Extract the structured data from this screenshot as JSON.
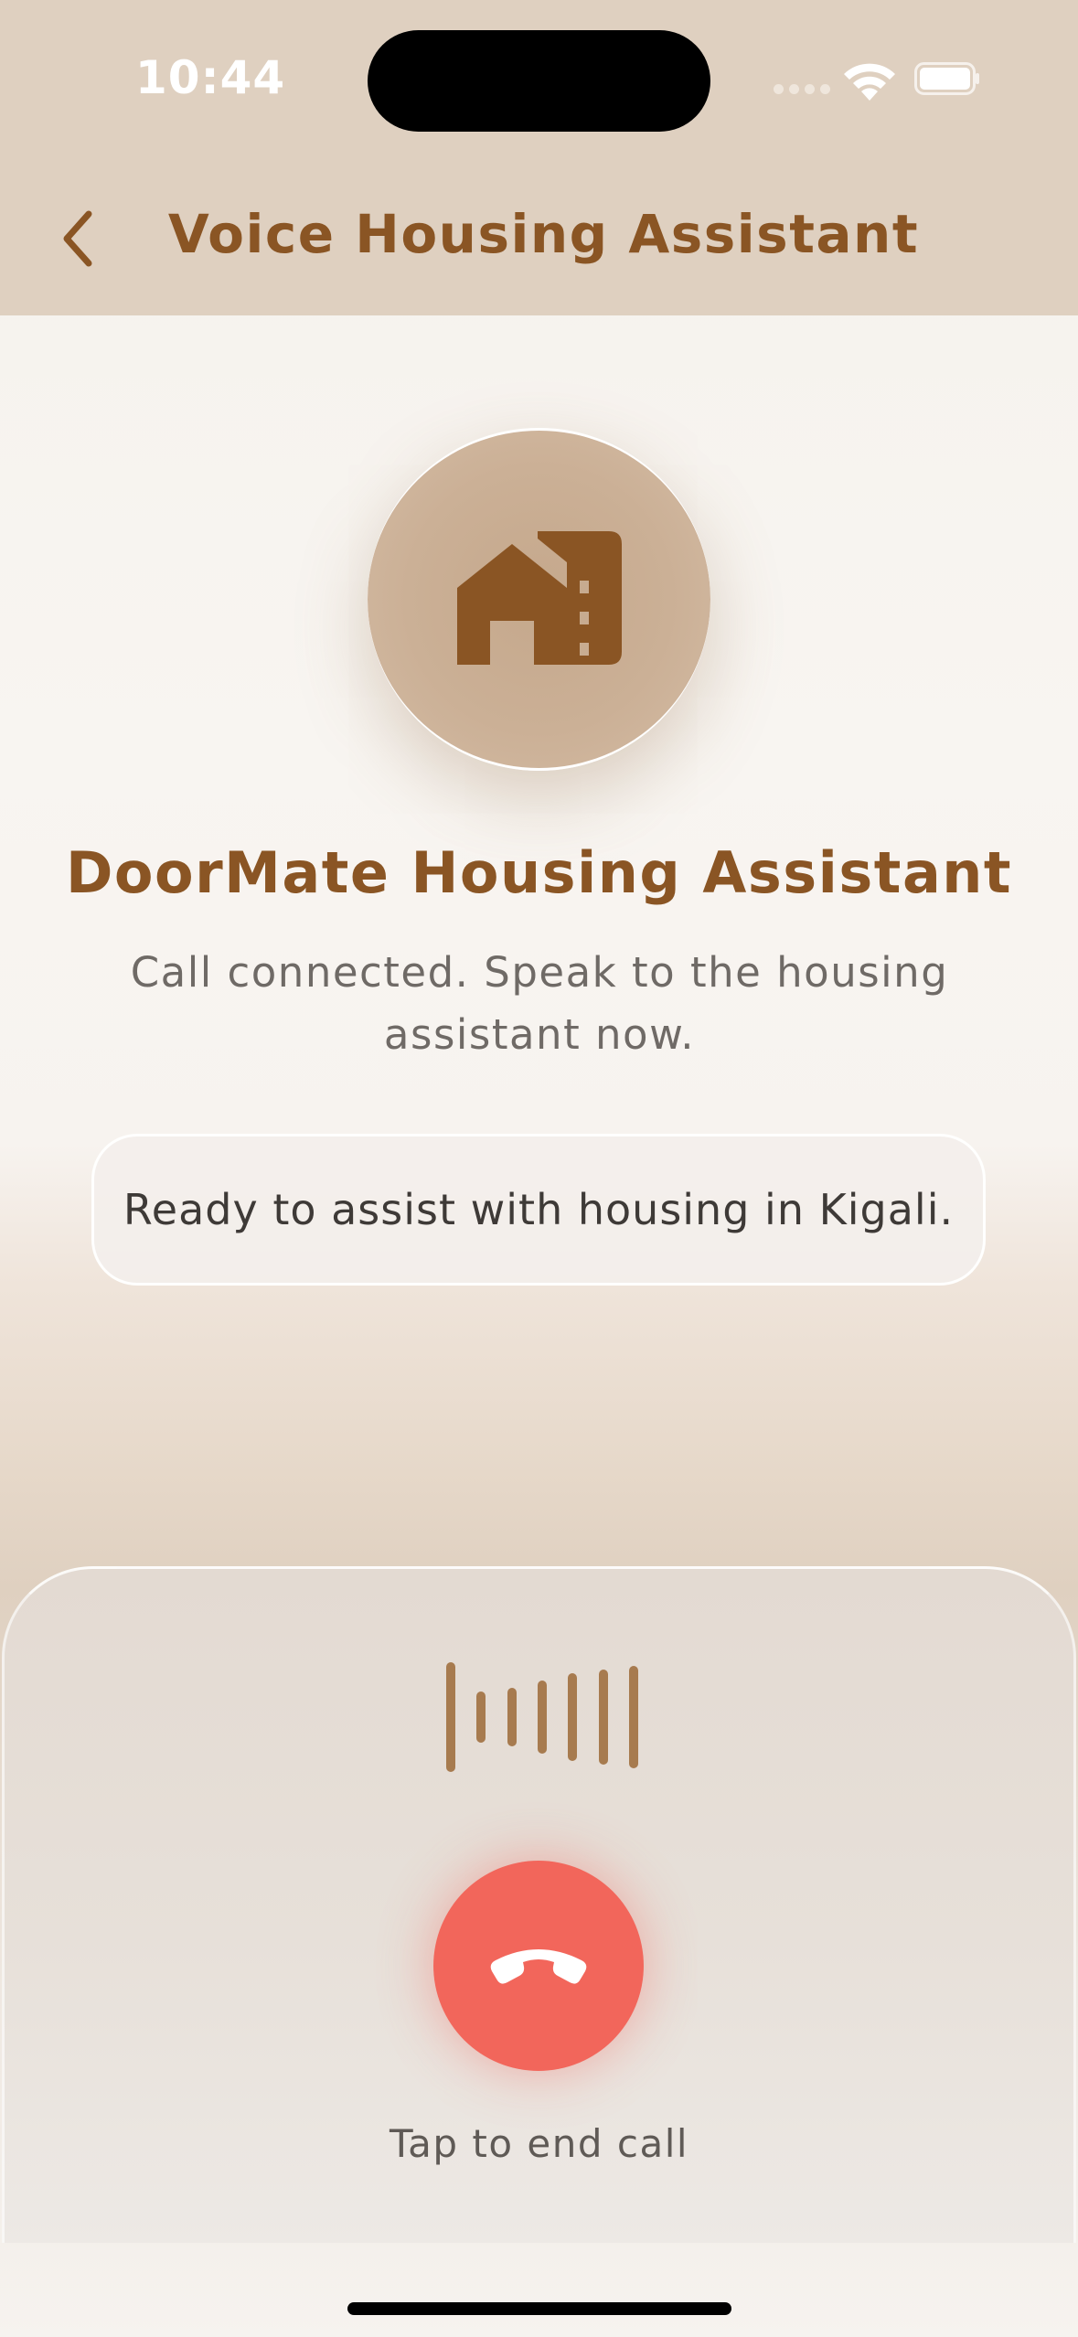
{
  "status_bar": {
    "time": "10:44",
    "icons": [
      "signal-icon",
      "wifi-icon",
      "battery-icon"
    ]
  },
  "header": {
    "back_icon": "chevron-left-icon",
    "title": "Voice Housing Assistant"
  },
  "assistant": {
    "avatar_icon": "house-building-icon",
    "name": "DoorMate Housing Assistant",
    "status": "Call connected. Speak to the housing assistant now."
  },
  "message": {
    "text": "Ready to assist with housing in Kigali."
  },
  "call_controls": {
    "waveform_icon": "waveform-icon",
    "end_call_icon": "phone-hangup-icon",
    "hint": "Tap to end call"
  },
  "colors": {
    "brand_brown": "#8a5524",
    "header_bg": "#dfd0c0",
    "end_call_red": "#f2665b",
    "waveform": "#a77b4f"
  }
}
